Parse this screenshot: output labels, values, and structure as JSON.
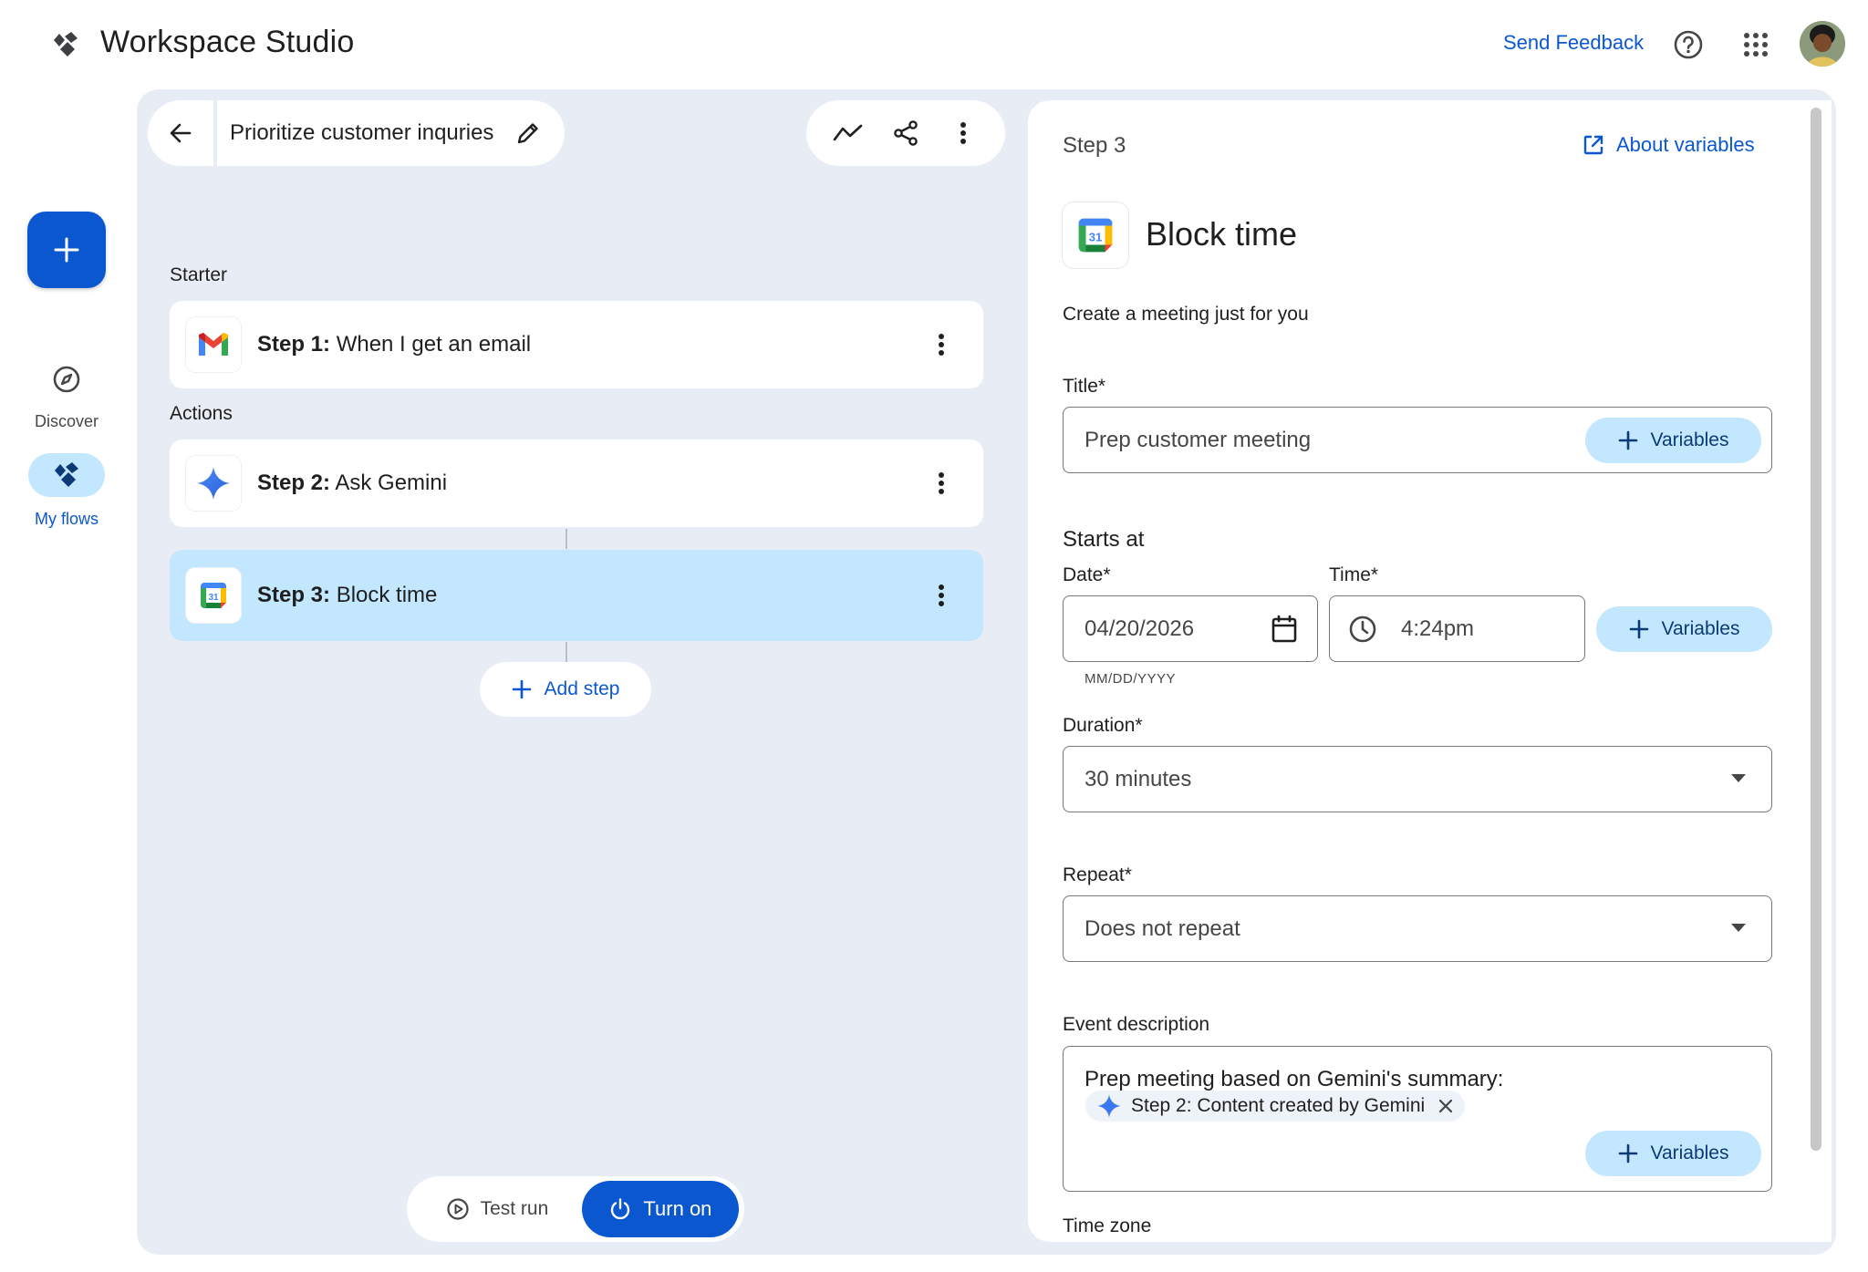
{
  "app": {
    "title": "Workspace Studio"
  },
  "header": {
    "send_feedback": "Send Feedback"
  },
  "rail": {
    "discover_label": "Discover",
    "myflows_label": "My flows"
  },
  "flow": {
    "title": "Prioritize customer inquries"
  },
  "sections": {
    "starter": "Starter",
    "actions": "Actions"
  },
  "steps": [
    {
      "prefix": "Step 1:",
      "label": "When I get an email",
      "icon": "gmail-icon"
    },
    {
      "prefix": "Step 2:",
      "label": "Ask Gemini",
      "icon": "gemini-icon"
    },
    {
      "prefix": "Step 3:",
      "label": "Block time",
      "icon": "calendar-icon",
      "selected": true
    }
  ],
  "add_step_label": "Add step",
  "run_bar": {
    "test_run": "Test run",
    "turn_on": "Turn on"
  },
  "panel": {
    "step_label": "Step 3",
    "about_variables": "About variables",
    "title": "Block time",
    "description": "Create a meeting just for you",
    "title_field": {
      "label": "Title*",
      "value": "Prep customer meeting"
    },
    "variables_label": "Variables",
    "starts_at": "Starts at",
    "date_field": {
      "label": "Date*",
      "value": "04/20/2026",
      "hint": "MM/DD/YYYY"
    },
    "time_field": {
      "label": "Time*",
      "value": "4:24pm"
    },
    "duration_field": {
      "label": "Duration*",
      "value": "30 minutes"
    },
    "repeat_field": {
      "label": "Repeat*",
      "value": "Does not repeat"
    },
    "event_description": {
      "label": "Event description",
      "text": "Prep meeting based on Gemini's summary:",
      "chip": "Step 2: Content created by Gemini"
    },
    "time_zone_label": "Time zone"
  },
  "colors": {
    "primary": "#0b57d0",
    "tonal": "#c2e7ff",
    "canvas": "#e8edf5"
  }
}
